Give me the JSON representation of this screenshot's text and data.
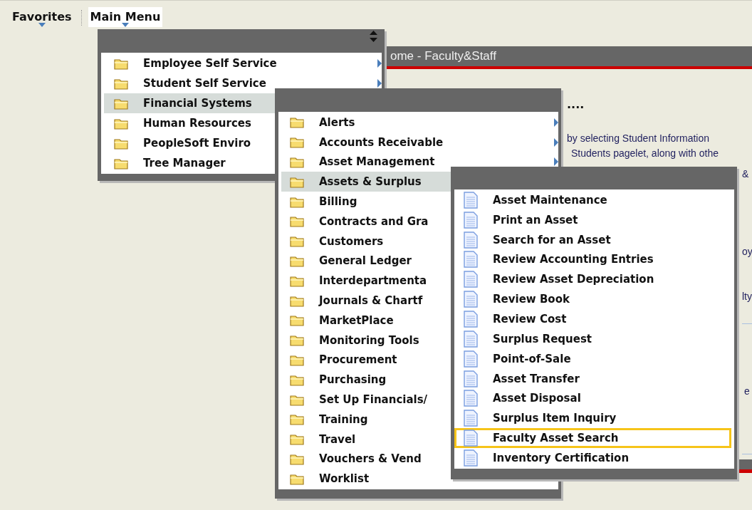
{
  "nav": [
    {
      "label": "Favorites",
      "selected": false
    },
    {
      "label": "Main Menu",
      "selected": true
    }
  ],
  "portal": {
    "pagelet_title": "ome - Faculty&Staff",
    "heading": "....",
    "lines": [
      "by selecting Student Information",
      "Students pagelet, along with othe"
    ],
    "edge_fragments": [
      "&",
      "oy",
      "lty",
      "e"
    ]
  },
  "menus": [
    {
      "items": [
        {
          "label": "Employee Self Service",
          "kind": "folder",
          "selected": false,
          "has_submenu": true
        },
        {
          "label": "Student Self Service",
          "kind": "folder",
          "selected": false,
          "has_submenu": true
        },
        {
          "label": "Financial Systems",
          "kind": "folder",
          "selected": true,
          "has_submenu": false
        },
        {
          "label": "Human Resources",
          "kind": "folder",
          "selected": false,
          "has_submenu": false
        },
        {
          "label": "PeopleSoft Enviro",
          "kind": "folder",
          "selected": false,
          "has_submenu": false
        },
        {
          "label": "Tree Manager",
          "kind": "folder",
          "selected": false,
          "has_submenu": false
        }
      ]
    },
    {
      "items": [
        {
          "label": "Alerts",
          "kind": "folder",
          "selected": false,
          "has_submenu": true
        },
        {
          "label": "Accounts Receivable",
          "kind": "folder",
          "selected": false,
          "has_submenu": true
        },
        {
          "label": "Asset Management",
          "kind": "folder",
          "selected": false,
          "has_submenu": true
        },
        {
          "label": "Assets & Surplus",
          "kind": "folder",
          "selected": true,
          "has_submenu": false
        },
        {
          "label": "Billing",
          "kind": "folder",
          "selected": false,
          "has_submenu": false
        },
        {
          "label": "Contracts and Gra",
          "kind": "folder",
          "selected": false,
          "has_submenu": false
        },
        {
          "label": "Customers",
          "kind": "folder",
          "selected": false,
          "has_submenu": false
        },
        {
          "label": "General Ledger",
          "kind": "folder",
          "selected": false,
          "has_submenu": false
        },
        {
          "label": "Interdepartmenta",
          "kind": "folder",
          "selected": false,
          "has_submenu": false
        },
        {
          "label": "Journals & Chartf",
          "kind": "folder",
          "selected": false,
          "has_submenu": false
        },
        {
          "label": "MarketPlace",
          "kind": "folder",
          "selected": false,
          "has_submenu": false
        },
        {
          "label": "Monitoring Tools",
          "kind": "folder",
          "selected": false,
          "has_submenu": false
        },
        {
          "label": "Procurement",
          "kind": "folder",
          "selected": false,
          "has_submenu": false
        },
        {
          "label": "Purchasing",
          "kind": "folder",
          "selected": false,
          "has_submenu": false
        },
        {
          "label": "Set Up Financials/",
          "kind": "folder",
          "selected": false,
          "has_submenu": false
        },
        {
          "label": "Training",
          "kind": "folder",
          "selected": false,
          "has_submenu": false
        },
        {
          "label": "Travel",
          "kind": "folder",
          "selected": false,
          "has_submenu": false
        },
        {
          "label": "Vouchers & Vend",
          "kind": "folder",
          "selected": false,
          "has_submenu": false
        },
        {
          "label": "Worklist",
          "kind": "folder",
          "selected": false,
          "has_submenu": false
        }
      ]
    },
    {
      "items": [
        {
          "label": "Asset Maintenance",
          "kind": "page",
          "selected": false,
          "outlined": false
        },
        {
          "label": "Print an Asset",
          "kind": "page",
          "selected": false,
          "outlined": false
        },
        {
          "label": "Search for an Asset",
          "kind": "page",
          "selected": false,
          "outlined": false
        },
        {
          "label": "Review Accounting Entries",
          "kind": "page",
          "selected": false,
          "outlined": false
        },
        {
          "label": "Review Asset Depreciation",
          "kind": "page",
          "selected": false,
          "outlined": false
        },
        {
          "label": "Review Book",
          "kind": "page",
          "selected": false,
          "outlined": false
        },
        {
          "label": "Review Cost",
          "kind": "page",
          "selected": false,
          "outlined": false
        },
        {
          "label": "Surplus Request",
          "kind": "page",
          "selected": false,
          "outlined": false
        },
        {
          "label": "Point-of-Sale",
          "kind": "page",
          "selected": false,
          "outlined": false
        },
        {
          "label": "Asset Transfer",
          "kind": "page",
          "selected": false,
          "outlined": false
        },
        {
          "label": "Asset Disposal",
          "kind": "page",
          "selected": false,
          "outlined": false
        },
        {
          "label": "Surplus Item Inquiry",
          "kind": "page",
          "selected": false,
          "outlined": false
        },
        {
          "label": "Faculty Asset Search",
          "kind": "page",
          "selected": false,
          "outlined": true
        },
        {
          "label": "Inventory Certification",
          "kind": "page",
          "selected": false,
          "outlined": false
        }
      ]
    }
  ]
}
